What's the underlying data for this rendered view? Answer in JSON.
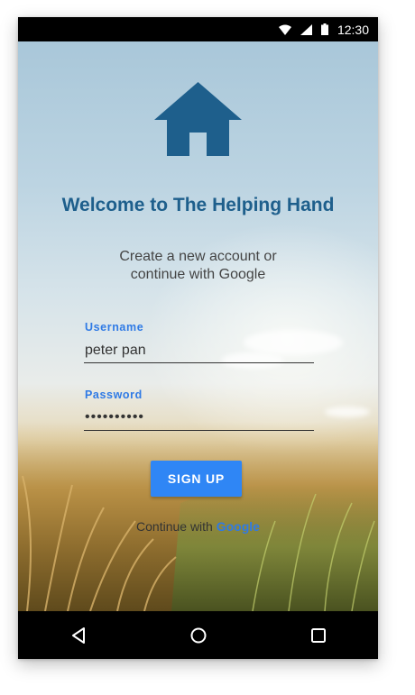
{
  "status_bar": {
    "time": "12:30",
    "icons": [
      "wifi-icon",
      "signal-icon",
      "battery-icon"
    ]
  },
  "app": {
    "logo": "house-icon",
    "title": "Welcome to The Helping Hand",
    "subtitle": "Create a new account or continue with Google",
    "username": {
      "label": "Username",
      "value": "peter pan"
    },
    "password": {
      "label": "Password",
      "masked_value": "••••••••••"
    },
    "signup_label": "SIGN UP",
    "continue_prefix": "Continue with ",
    "continue_provider": "Google"
  },
  "nav_bar": {
    "buttons": [
      "back-icon",
      "home-icon",
      "recents-icon"
    ]
  },
  "colors": {
    "title": "#1e5f8c",
    "accent": "#2f86f5",
    "label": "#2f7ae5"
  }
}
